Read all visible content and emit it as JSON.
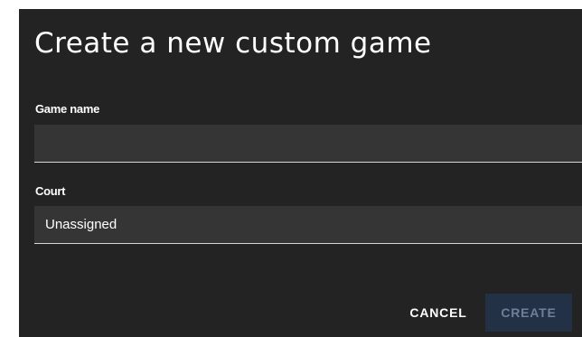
{
  "dialog": {
    "title": "Create a new custom game",
    "game_name": {
      "label": "Game name",
      "value": "",
      "placeholder": ""
    },
    "court": {
      "label": "Court",
      "selected": "Unassigned"
    },
    "buttons": {
      "cancel": "CANCEL",
      "create": "CREATE"
    }
  },
  "colors": {
    "dialog_bg": "#232323",
    "field_bg": "#353535",
    "create_bg": "#223145",
    "create_text": "#6e7f96"
  }
}
